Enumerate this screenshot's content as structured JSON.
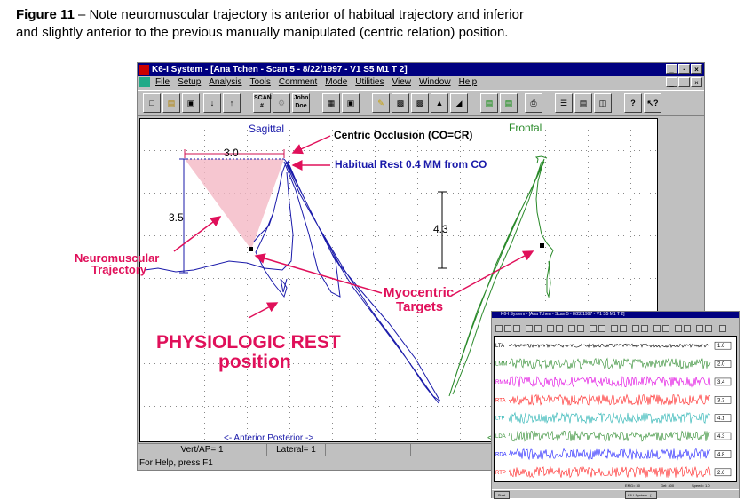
{
  "caption": {
    "label": "Figure 11",
    "text": " – Note neuromuscular trajectory is anterior of habitual trajectory and inferior",
    "line2": "and slightly anterior to the previous manually manipulated (centric relation) position."
  },
  "window": {
    "title": "K6-I System - [Ana Tchen - Scan 5 - 8/22/1997 - V1 S5    M1   T 2]",
    "menus": [
      "File",
      "Setup",
      "Analysis",
      "Tools",
      "Comment",
      "Mode",
      "Utilities",
      "View",
      "Window",
      "Help"
    ],
    "window_buttons": [
      "_",
      "·",
      "×"
    ],
    "toolbar_icons": [
      "new-icon",
      "open-icon",
      "save-icon",
      "down-arrow-icon",
      "up-arrow-icon",
      "scan-icon",
      "scale-icon",
      "patient-icon",
      "grid-icon",
      "monitor-icon",
      "pen-icon",
      "chart-a-icon",
      "chart-b-icon",
      "chart-c-icon",
      "chart-d-icon",
      "stack-a-icon",
      "stack-b-icon",
      "print-icon",
      "rows-icon",
      "rows2-icon",
      "columns-icon",
      "help-icon",
      "context-help-icon"
    ],
    "scan_label": "SCAN\n#",
    "patient_label": "John\nDoe"
  },
  "plot": {
    "sagittal_label": "Sagittal",
    "frontal_label": "Frontal",
    "dim_3_0": "3.0",
    "dim_3_5": "3.5",
    "dim_4_3": "4.3",
    "anterior_posterior": "<- Anterior    Posterior ->",
    "frontal_partial": "<"
  },
  "annotations": {
    "centric_occlusion": "Centric Occlusion (CO=CR)",
    "habitual_rest": "Habitual Rest 0.4 MM from CO",
    "neuromuscular": "Neuromuscular",
    "trajectory": "Trajectory",
    "myocentric": "Myocentric",
    "targets": "Targets",
    "physiologic_rest": "PHYSIOLOGIC REST",
    "position": "position"
  },
  "status": {
    "vert_ap": "Vert/AP= 1",
    "lateral": "Lateral= 1",
    "help": "For Help, press F1"
  },
  "emg_window": {
    "title": "K6-I System - [Ana Tchen - Scan 5 - 8/22/1997 - V1 S5 M1 T 2]",
    "channels": [
      {
        "name": "LTA",
        "value": "1.6",
        "color": "#000000"
      },
      {
        "name": "LMM",
        "value": "2.0",
        "color": "#2e8b2e"
      },
      {
        "name": "RMM",
        "value": "3.4",
        "color": "#e000e0"
      },
      {
        "name": "RTA",
        "value": "3.3",
        "color": "#ff2020"
      },
      {
        "name": "LTP",
        "value": "4.1",
        "color": "#20b0b0"
      },
      {
        "name": "LDA",
        "value": "4.3",
        "color": "#2e8b2e"
      },
      {
        "name": "RDA",
        "value": "4.8",
        "color": "#2020ff"
      },
      {
        "name": "RTP",
        "value": "2.6",
        "color": "#ff2020"
      }
    ],
    "status_items": [
      "EMG= 30",
      "Gel: 400",
      "Speed= 1.0"
    ],
    "start_label": "Start",
    "taskbar_item": "K6-I System - [..."
  },
  "colors": {
    "sagittal_trace": "#1a1aaa",
    "frontal_trace": "#2a8a2a",
    "annotation_red": "#e0105a",
    "label_blue": "#1a1aaa"
  }
}
